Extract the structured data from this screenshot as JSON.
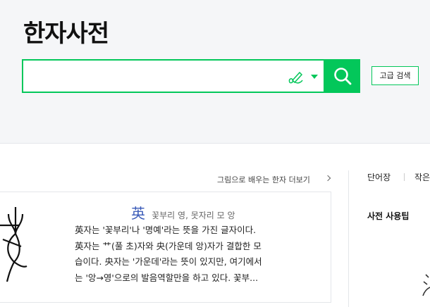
{
  "header": {
    "title": "한자사전"
  },
  "search": {
    "placeholder": "",
    "value": "",
    "advanced_label": "고급 검색"
  },
  "icons": {
    "handwrite": "handwriting-pen-icon",
    "dropdown": "caret-down-icon",
    "search": "search-icon",
    "more": "chevron-right-icon"
  },
  "colors": {
    "accent": "#03c75a",
    "hanja": "#3a5bb8",
    "hero_bg": "#f5f6f8"
  },
  "learn": {
    "more_link": "그림으로 배우는 한자 더보기",
    "hanja": "英",
    "reading": "꽃부리 영, 못자리 모 앙",
    "desc_lines": [
      "英자는 '꽃부리'나 '명예'라는 뜻을 가진 글자이다.",
      "英자는 艹(풀 초)자와 央(가운데 앙)자가 결합한 모",
      "습이다. 央자는 '가운데'라는 뜻이 있지만, 여기에서",
      "는 '앙→영'으로의 발음역할만을 하고 있다. 꽃부..."
    ]
  },
  "right_panel": {
    "tab1": "단어장",
    "tab2": "작은",
    "heading": "사전 사용팁"
  }
}
